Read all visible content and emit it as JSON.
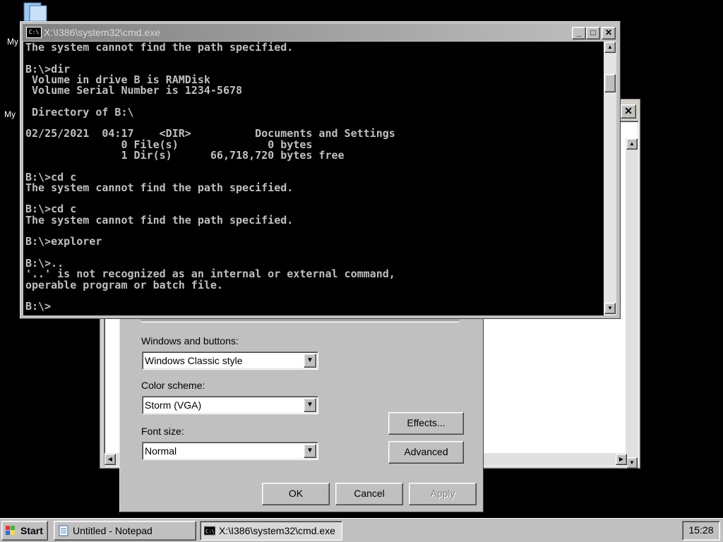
{
  "desktop": {
    "icons": [
      {
        "name": "my-documents-icon",
        "label": "My"
      },
      {
        "name": "my-computer-icon",
        "label": "My"
      }
    ]
  },
  "cmd": {
    "title": "X:\\I386\\system32\\cmd.exe",
    "icon_text": "C:\\",
    "lines": [
      "The system cannot find the path specified.",
      "",
      "B:\\>dir",
      " Volume in drive B is RAMDisk",
      " Volume Serial Number is 1234-5678",
      "",
      " Directory of B:\\",
      "",
      "02/25/2021  04:17    <DIR>          Documents and Settings",
      "               0 File(s)              0 bytes",
      "               1 Dir(s)      66,718,720 bytes free",
      "",
      "B:\\>cd c",
      "The system cannot find the path specified.",
      "",
      "B:\\>cd c",
      "The system cannot find the path specified.",
      "",
      "B:\\>explorer",
      "",
      "B:\\>..",
      "'..' is not recognized as an internal or external command,",
      "operable program or batch file.",
      "",
      "B:\\>"
    ]
  },
  "dialog": {
    "windows_buttons_label": "Windows and buttons:",
    "windows_buttons_value": "Windows Classic style",
    "color_scheme_label": "Color scheme:",
    "color_scheme_value": "Storm (VGA)",
    "font_size_label": "Font size:",
    "font_size_value": "Normal",
    "effects_label": "Effects...",
    "advanced_label": "Advanced",
    "ok_label": "OK",
    "cancel_label": "Cancel",
    "apply_label": "Apply"
  },
  "taskbar": {
    "start_label": "Start",
    "tasks": [
      {
        "label": "Untitled - Notepad"
      },
      {
        "label": "X:\\I386\\system32\\cmd.exe"
      }
    ],
    "clock": "15:28"
  }
}
